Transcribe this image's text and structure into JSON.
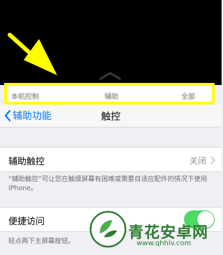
{
  "control_bar": {
    "left_text": "本机控制",
    "center_text": "辅助",
    "right_text": "全部"
  },
  "navbar": {
    "back_label": "辅助功能",
    "title": "触控"
  },
  "assistive_touch": {
    "label": "辅助触控",
    "value": "关闭"
  },
  "assistive_touch_footer": "“辅助触控”可让您在触摸屏幕有困难或需要自适应配件的情况下使用iPhone。",
  "reachability": {
    "label": "便捷访问",
    "enabled": true
  },
  "reachability_footer": "轻点两下主屏幕按钮。",
  "watermark": {
    "title": "青花安卓网",
    "url": "www.qhhlv.com"
  },
  "colors": {
    "highlight": "#ffff00",
    "accent": "#007aff",
    "toggle_on": "#4cd964",
    "watermark": "#2e7d32"
  }
}
